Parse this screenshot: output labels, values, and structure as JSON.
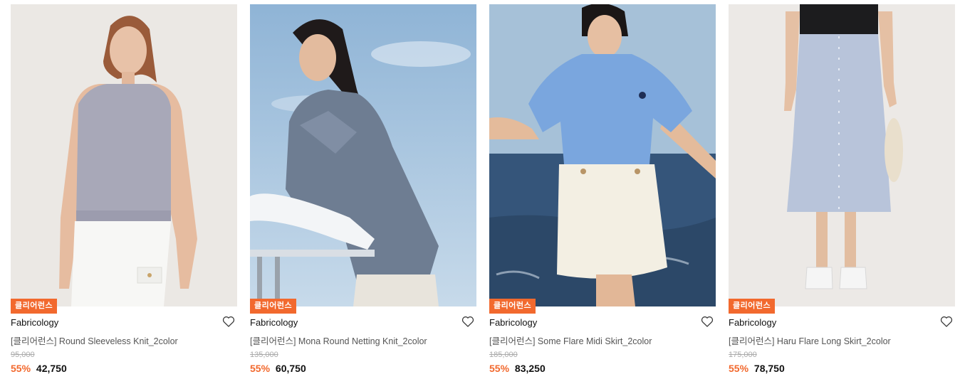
{
  "colors": {
    "accent": "#f2692e"
  },
  "products": [
    {
      "badge": "클리어런스",
      "brand": "Fabricology",
      "name": "[클리어런스] Round Sleeveless Knit_2color",
      "original_price": "95,000",
      "discount": "55%",
      "price": "42,750",
      "wishlist_icon": "heart-outline-icon"
    },
    {
      "badge": "클리어런스",
      "brand": "Fabricology",
      "name": "[클리어런스] Mona Round Netting Knit_2color",
      "original_price": "135,000",
      "discount": "55%",
      "price": "60,750",
      "wishlist_icon": "heart-outline-icon"
    },
    {
      "badge": "클리어런스",
      "brand": "Fabricology",
      "name": "[클리어런스] Some Flare Midi Skirt_2color",
      "original_price": "185,000",
      "discount": "55%",
      "price": "83,250",
      "wishlist_icon": "heart-outline-icon"
    },
    {
      "badge": "클리어런스",
      "brand": "Fabricology",
      "name": "[클리어런스] Haru Flare Long Skirt_2color",
      "original_price": "175,000",
      "discount": "55%",
      "price": "78,750",
      "wishlist_icon": "heart-outline-icon"
    }
  ]
}
